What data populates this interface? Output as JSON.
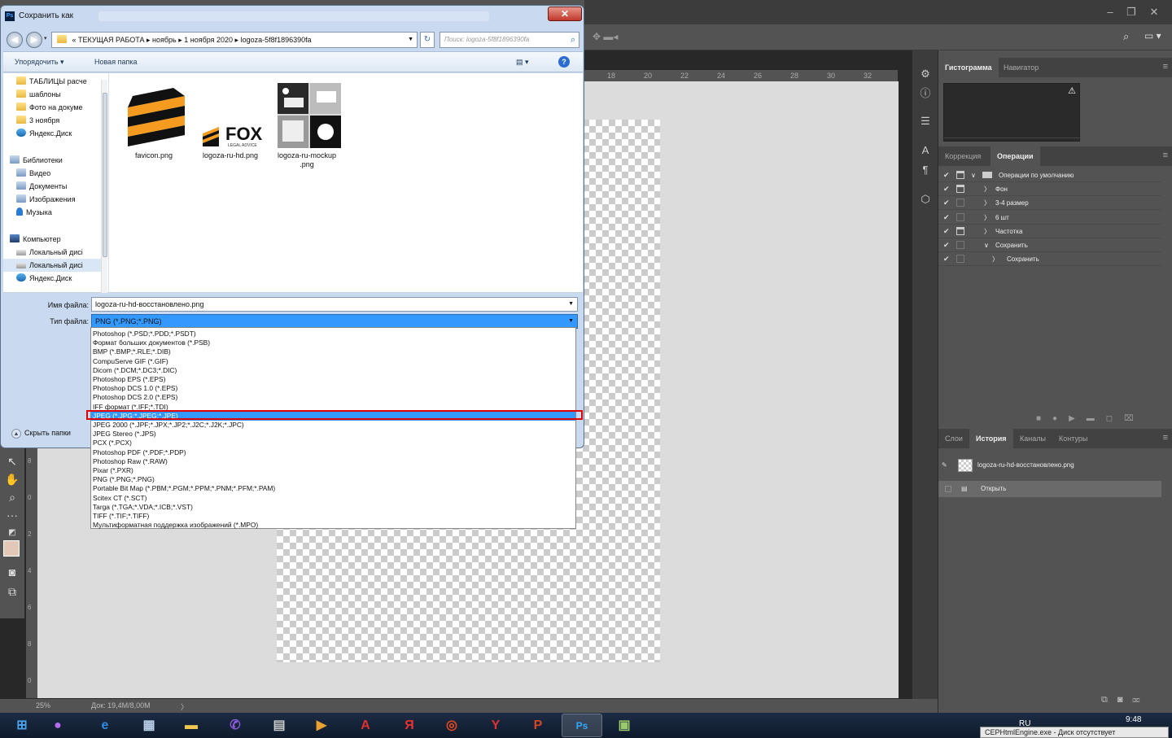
{
  "dialog": {
    "title": "Сохранить как",
    "app_icon_text": "Ps",
    "close_glyph": "✕",
    "address": {
      "prefix": "«",
      "crumbs": [
        "ТЕКУЩАЯ РАБОТА",
        "ноябрь",
        "1 ноября 2020",
        "logoza-5f8f1896390fa"
      ]
    },
    "search_placeholder": "Поиск: logoza-5f8f1896390fa",
    "toolbar": {
      "organize": "Упорядочить ▾",
      "new_folder": "Новая папка",
      "help_glyph": "?"
    },
    "nav_items": [
      {
        "label": "ТАБЛИЦЫ расче",
        "icon": "folder-icon"
      },
      {
        "label": "шаблоны",
        "icon": "folder-icon"
      },
      {
        "label": "Фото на докуме",
        "icon": "folder-icon"
      },
      {
        "label": "3 ноября",
        "icon": "folder-icon"
      },
      {
        "label": "Яндекс.Диск",
        "icon": "cloud-icon"
      },
      {
        "label": "Библиотеки",
        "icon": "library-icon"
      },
      {
        "label": "Видео",
        "icon": "video-icon"
      },
      {
        "label": "Документы",
        "icon": "documents-icon"
      },
      {
        "label": "Изображения",
        "icon": "images-icon"
      },
      {
        "label": "Музыка",
        "icon": "music-icon"
      },
      {
        "label": "Компьютер",
        "icon": "computer-icon"
      },
      {
        "label": "Локальный дисі",
        "icon": "drive-icon"
      },
      {
        "label": "Локальный дисі",
        "icon": "drive-icon"
      },
      {
        "label": "Яндекс.Диск",
        "icon": "cloud-icon"
      }
    ],
    "files": [
      {
        "name": "favicon.png"
      },
      {
        "name": "logoza-ru-hd.png",
        "logo_text": "FOX",
        "logo_sub": "LEGAL ADVICE"
      },
      {
        "name_line1": "logoza-ru-mockup",
        "name_line2": ".png"
      }
    ],
    "filename_label": "Имя файла:",
    "filename_value": "logoza-ru-hd-восстановлено.png",
    "filetype_label": "Тип файла:",
    "filetype_value": "PNG (*.PNG;*.PNG)",
    "hide_folders": "Скрыть папки",
    "filetype_options": [
      "Photoshop (*.PSD;*.PDD;*.PSDT)",
      "Формат больших документов (*.PSB)",
      "BMP (*.BMP;*.RLE;*.DIB)",
      "CompuServe GIF (*.GIF)",
      "Dicom (*.DCM;*.DC3;*.DIC)",
      "Photoshop EPS (*.EPS)",
      "Photoshop DCS 1.0 (*.EPS)",
      "Photoshop DCS 2.0 (*.EPS)",
      "IFF формат (*.IFF;*.TDI)",
      "JPEG (*.JPG;*.JPEG;*.JPE)",
      "JPEG 2000 (*.JPF;*.JPX;*.JP2;*.J2C;*.J2K;*.JPC)",
      "JPEG Stereo (*.JPS)",
      "PCX (*.PCX)",
      "Photoshop PDF (*.PDF;*.PDP)",
      "Photoshop Raw (*.RAW)",
      "Pixar (*.PXR)",
      "PNG (*.PNG;*.PNG)",
      "Portable Bit Map (*.PBM;*.PGM;*.PPM;*.PNM;*.PFM;*.PAM)",
      "Scitex CT (*.SCT)",
      "Targa (*.TGA;*.VDA;*.ICB;*.VST)",
      "TIFF (*.TIF;*.TIFF)",
      "Мультиформатная поддержка изображений  (*.MPO)"
    ],
    "highlighted_option_index": 9
  },
  "photoshop": {
    "window_controls": [
      "–",
      "❐",
      "✕"
    ],
    "ruler_top": [
      "18",
      "20",
      "22",
      "24",
      "26",
      "28",
      "30",
      "32"
    ],
    "ruler_left": [
      "8",
      "0",
      "2",
      "4",
      "6",
      "8",
      "0"
    ],
    "status": {
      "zoom": "25%",
      "doc": "Док: 19,4M/8,00M",
      "arrow": "〉"
    },
    "panels": {
      "top_tabs": [
        "Гистограмма",
        "Навигатор"
      ],
      "mid_tabs": [
        "Коррекция",
        "Операции"
      ],
      "bottom_tabs": [
        "Слои",
        "История",
        "Каналы",
        "Контуры"
      ],
      "histogram_warning": "⚠",
      "actions": [
        {
          "label": "Операции по умолчанию",
          "arrow": "∨"
        },
        {
          "label": "Фон",
          "arrow": "〉"
        },
        {
          "label": "3-4 размер",
          "arrow": "〉"
        },
        {
          "label": "6 шт",
          "arrow": "〉"
        },
        {
          "label": "Частотка",
          "arrow": "〉"
        },
        {
          "label": "Сохранить",
          "arrow": "∨"
        },
        {
          "label": "Сохранить",
          "arrow": "〉"
        }
      ],
      "history": [
        {
          "label": "logoza-ru-hd-восстановлено.png"
        },
        {
          "label": "Открыть"
        }
      ],
      "check_glyph": "✔"
    }
  },
  "taskbar": {
    "apps": [
      {
        "name": "start",
        "glyph": "⊞",
        "color": "#4aa3e8"
      },
      {
        "name": "app-purple",
        "glyph": "●",
        "color": "#b36cf0"
      },
      {
        "name": "ie",
        "glyph": "e",
        "color": "#2f8ce0"
      },
      {
        "name": "calculator",
        "glyph": "▦",
        "color": "#b8d0e8"
      },
      {
        "name": "explorer",
        "glyph": "▬",
        "color": "#f0c850"
      },
      {
        "name": "viber",
        "glyph": "✆",
        "color": "#8a5bd8"
      },
      {
        "name": "scanner",
        "glyph": "▤",
        "color": "#c8c8c8"
      },
      {
        "name": "media",
        "glyph": "▶",
        "color": "#e8a030"
      },
      {
        "name": "acrobat",
        "glyph": "A",
        "color": "#e03030"
      },
      {
        "name": "yandex",
        "glyph": "Я",
        "color": "#e83030"
      },
      {
        "name": "app-red",
        "glyph": "◎",
        "color": "#e84820"
      },
      {
        "name": "yandex-browser",
        "glyph": "Y",
        "color": "#e03030"
      },
      {
        "name": "powerpoint",
        "glyph": "P",
        "color": "#d24726"
      },
      {
        "name": "photoshop",
        "glyph": "Ps",
        "color": "#31a8ff"
      },
      {
        "name": "app-window",
        "glyph": "▣",
        "color": "#9ac86a"
      }
    ],
    "lang": "RU",
    "time": "9:48",
    "tooltip": "CEPHtmlEngine.exe - Диск отсутствует"
  }
}
